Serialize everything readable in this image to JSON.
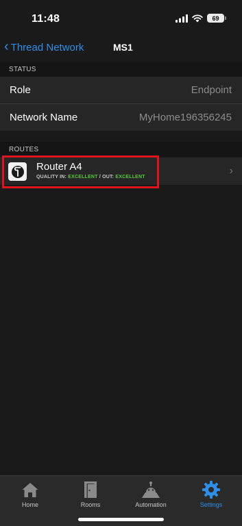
{
  "status_bar": {
    "time": "11:48",
    "battery": "69",
    "signal_icon": "cellular-signal-icon",
    "wifi_icon": "wifi-icon"
  },
  "nav": {
    "back_label": "Thread Network",
    "title": "MS1"
  },
  "status_section": {
    "header": "STATUS",
    "rows": [
      {
        "label": "Role",
        "value": "Endpoint"
      },
      {
        "label": "Network Name",
        "value": "MyHome196356245"
      }
    ]
  },
  "routes_section": {
    "header": "ROUTES",
    "items": [
      {
        "name": "Router A4",
        "quality_prefix": "QUALITY IN: ",
        "quality_in": "EXCELLENT",
        "quality_sep": " / OUT: ",
        "quality_out": "EXCELLENT",
        "icon": "thread-logo-icon"
      }
    ]
  },
  "tab_bar": {
    "tabs": [
      {
        "label": "Home",
        "icon": "home-icon",
        "active": false
      },
      {
        "label": "Rooms",
        "icon": "door-icon",
        "active": false
      },
      {
        "label": "Automation",
        "icon": "robot-icon",
        "active": false
      },
      {
        "label": "Settings",
        "icon": "gear-icon",
        "active": true
      }
    ]
  },
  "colors": {
    "accent": "#2f8ee6",
    "quality_good": "#58c73a",
    "highlight": "#e0141c",
    "background": "#1a1a1a",
    "row_background": "#262626"
  }
}
